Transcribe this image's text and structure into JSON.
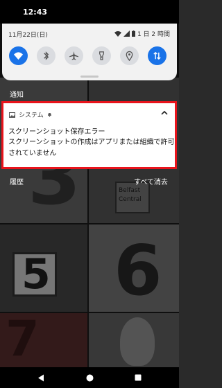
{
  "status_bar": {
    "time": "12:43"
  },
  "quick_settings": {
    "date": "11月22日(日)",
    "battery_text": "1 日 2 時間",
    "tiles": [
      {
        "icon": "wifi-icon",
        "active": true
      },
      {
        "icon": "bluetooth-icon",
        "active": false
      },
      {
        "icon": "airplane-icon",
        "active": false
      },
      {
        "icon": "flashlight-icon",
        "active": false
      },
      {
        "icon": "location-icon",
        "active": false
      },
      {
        "icon": "data-transfer-icon",
        "active": true
      }
    ],
    "accent_color": "#1a73e8"
  },
  "notifications_section": {
    "label": "通知"
  },
  "notification": {
    "app_name": "システム",
    "title": "スクリーンショット保存エラー",
    "body": "スクリーンショットの作成はアプリまたは組織で許可されていません",
    "highlight_color": "#e8141c"
  },
  "history": {
    "label": "履歴",
    "clear_all": "すべて消去"
  },
  "wallpaper": {
    "tiles": [
      "3",
      "5",
      "6",
      "7",
      "Belfast",
      "Central"
    ]
  },
  "nav_bar": {
    "buttons": [
      "back-icon",
      "home-icon",
      "recents-icon"
    ]
  }
}
